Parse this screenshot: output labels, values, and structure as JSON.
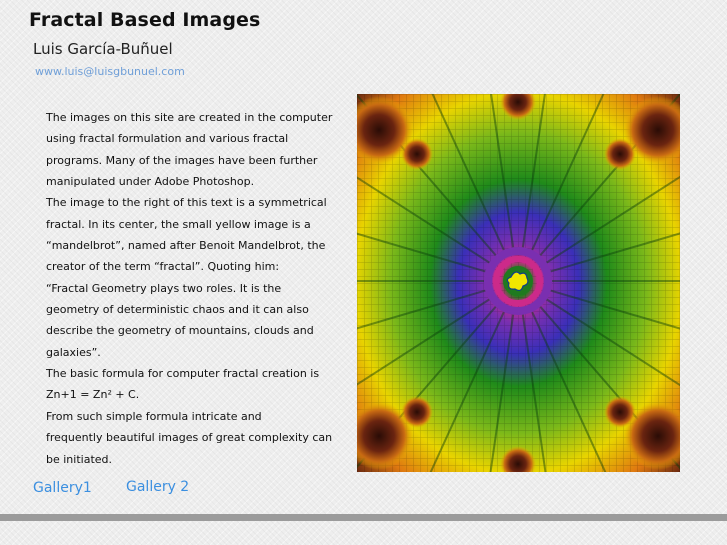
{
  "header": {
    "title": "Fractal Based Images",
    "author": "Luis García-Buñuel",
    "website": "www.luis@luisgbunuel.com"
  },
  "intro": {
    "lines": [
      "The images on this site are created in the computer",
      "using fractal formulation and various fractal",
      "programs. Many of the images have been further",
      "manipulated under Adobe Photoshop.",
      "The image to the right of this text is a symmetrical",
      "fractal. In its center, the small yellow image is a",
      "“mandelbrot”, named after Benoit Mandelbrot, the",
      "creator of the term “fractal”. Quoting him:",
      "“Fractal Geometry plays two roles. It is the",
      "geometry of deterministic chaos and it can also",
      "describe the geometry of mountains, clouds and",
      "galaxies”.",
      "The basic formula for computer fractal creation is",
      "Zn+1 = Zn² + C.",
      "From such simple formula intricate and",
      "frequently beautiful images of great complexity can",
      "be initiated."
    ]
  },
  "nav": {
    "gallery1": "Gallery1",
    "gallery2": "Gallery 2"
  },
  "colors": {
    "title": "#111111",
    "link": "#3b8fe0",
    "website_link": "#6f9fd8",
    "footer_bar": "#9b9b9b",
    "fractal_center": "#f2e600",
    "fractal_ring_inner": "#cc2a8a",
    "fractal_ring_mid": "#4a2fb8",
    "fractal_green": "#1f8a1a",
    "fractal_yellow": "#e8d400",
    "fractal_orange": "#e07a10",
    "fractal_dark": "#5a1d10"
  }
}
